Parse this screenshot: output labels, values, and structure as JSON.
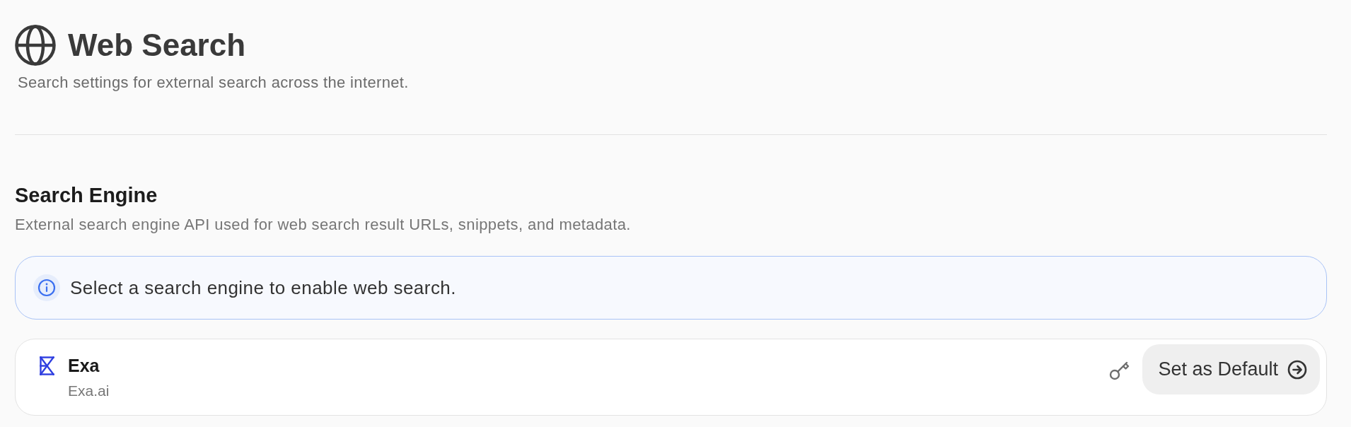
{
  "header": {
    "title": "Web Search",
    "subtitle": "Search settings for external search across the internet."
  },
  "section": {
    "title": "Search Engine",
    "description": "External search engine API used for web search result URLs, snippets, and metadata.",
    "notice": {
      "kind": "info",
      "text": "Select a search engine to enable web search."
    },
    "providers": [
      {
        "name": "Exa",
        "domain": "Exa.ai",
        "action": "Set as Default"
      }
    ]
  }
}
